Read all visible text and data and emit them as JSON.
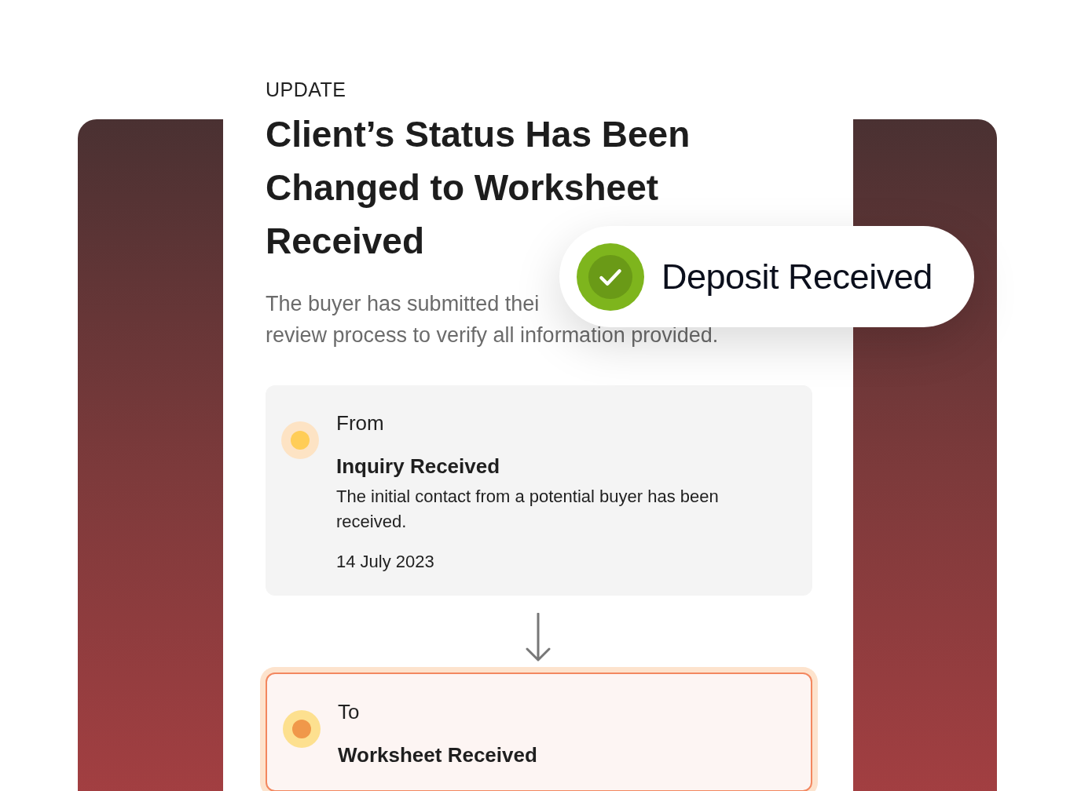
{
  "eyebrow": "UPDATE",
  "title": "Client’s Status Has Been Changed to Worksheet Received",
  "description_lines": [
    "The buyer has submitted thei",
    "review process to verify all information provided."
  ],
  "steps": [
    {
      "kind": "from",
      "label": "From",
      "status": "Inquiry Received",
      "description": "The initial contact from a potential buyer has been received.",
      "date": "14 July 2023",
      "current": false,
      "color": "#ffcd57"
    },
    {
      "kind": "to",
      "label": "To",
      "status": "Worksheet Received",
      "current": true,
      "color": "#f0984a"
    }
  ],
  "toast": {
    "text": "Deposit Received",
    "checked": true
  }
}
